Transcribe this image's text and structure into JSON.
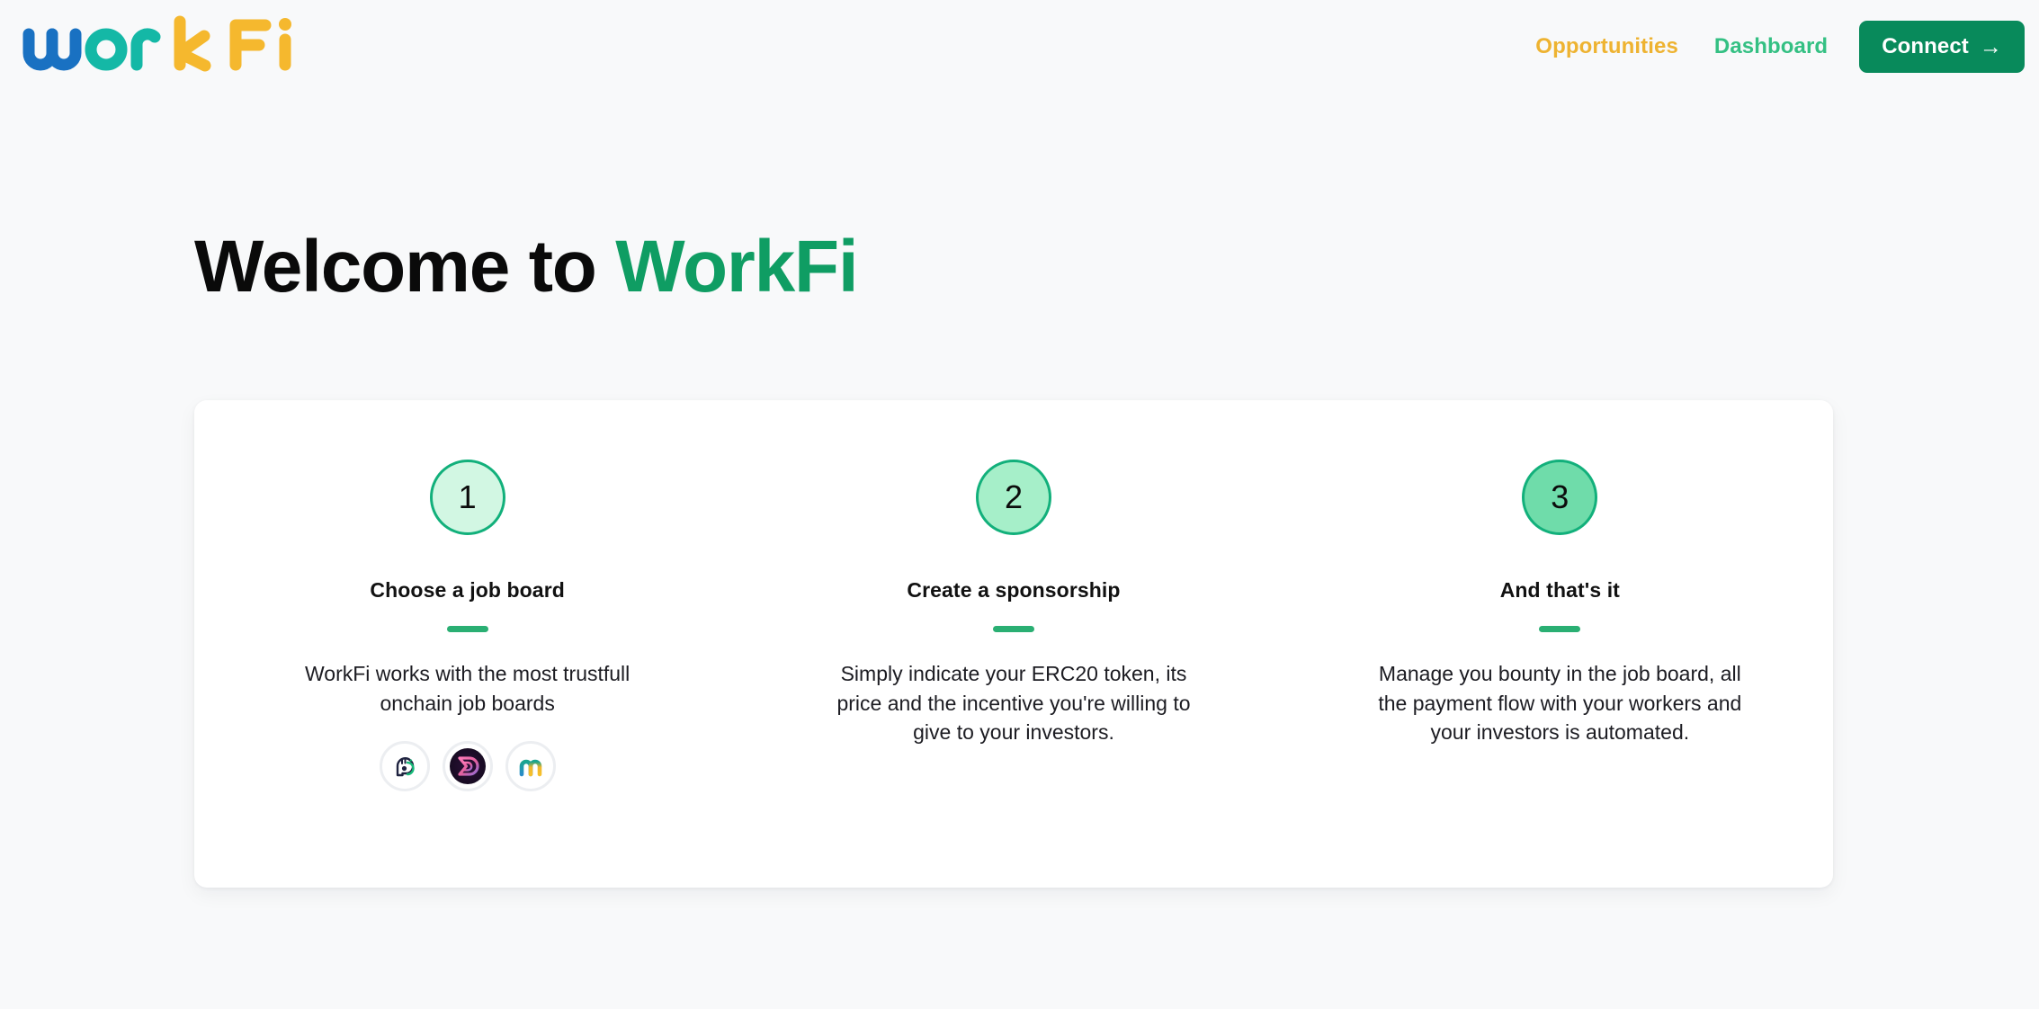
{
  "brand": {
    "logo_text": "workFi",
    "logo_letters": [
      {
        "char": "w",
        "color": "#1971c2"
      },
      {
        "char": "o",
        "color": "#14b8a6"
      },
      {
        "char": "r",
        "color": "#14b8a6"
      },
      {
        "char": "k",
        "color": "#f5b82e"
      },
      {
        "char": "F",
        "color": "#f5b82e"
      },
      {
        "char": "i",
        "color": "#f5b82e"
      }
    ]
  },
  "header": {
    "nav": [
      {
        "label": "Opportunities",
        "color": "#eeb331",
        "name": "nav-opportunities"
      },
      {
        "label": "Dashboard",
        "color": "#34c083",
        "name": "nav-dashboard"
      }
    ],
    "connect_button": {
      "label": "Connect",
      "arrow": "→",
      "bg": "#088a5b",
      "text_color": "#ffffff"
    }
  },
  "hero": {
    "title_prefix": "Welcome to",
    "title_accent": "WorkFi",
    "accent_color": "#0f9d63"
  },
  "card": {
    "steps": [
      {
        "number": "1",
        "title": "Choose a job board",
        "description": "WorkFi works with the most trustfull onchain job boards",
        "circle_fill": "#d2f7e3",
        "circle_border": "#12b07b",
        "rule_color": "#2aaf73",
        "job_boards": [
          {
            "name": "cryptojobslist-logo",
            "label": "Crypto Jobs List"
          },
          {
            "name": "dework-logo",
            "label": "Dework"
          },
          {
            "name": "mirror-logo",
            "label": "Mirror"
          }
        ]
      },
      {
        "number": "2",
        "title": "Create a sponsorship",
        "description": "Simply indicate your ERC20 token, its price and the incentive you're willing to give to your investors.",
        "circle_fill": "#a6efc9",
        "circle_border": "#12b07b",
        "rule_color": "#2aaf73",
        "job_boards": []
      },
      {
        "number": "3",
        "title": "And that's it",
        "description": "Manage you bounty in the job board, all the payment flow with your workers and your investors is automated.",
        "circle_fill": "#6fdcaa",
        "circle_border": "#12b07b",
        "rule_color": "#2aaf73",
        "job_boards": []
      }
    ]
  },
  "theme": {
    "page_bg": "#f8f9fa",
    "card_bg": "#ffffff",
    "text_color": "#1c1c22"
  }
}
